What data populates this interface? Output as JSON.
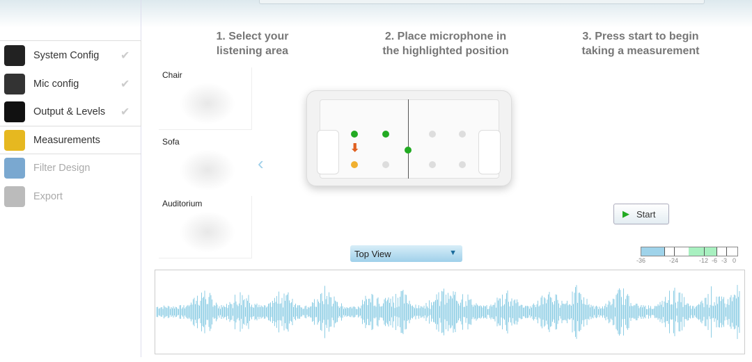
{
  "sidebar": {
    "items": [
      {
        "label": "System Config",
        "done": true,
        "icon": "speaker-icon",
        "enabled": true
      },
      {
        "label": "Mic config",
        "done": true,
        "icon": "microphone-icon",
        "enabled": true
      },
      {
        "label": "Output & Levels",
        "done": true,
        "icon": "knob-icon",
        "enabled": true
      },
      {
        "label": "Measurements",
        "done": false,
        "icon": "tape-measure-icon",
        "enabled": true,
        "active": true
      },
      {
        "label": "Filter Design",
        "done": false,
        "icon": "waveform-monitor-icon",
        "enabled": false
      },
      {
        "label": "Export",
        "done": false,
        "icon": "export-icon",
        "enabled": false
      }
    ]
  },
  "steps": [
    "1. Select your\nlistening area",
    "2. Place microphone in\nthe highlighted position",
    "3. Press start to begin\ntaking a measurement"
  ],
  "areas": [
    "Chair",
    "Sofa",
    "Auditorium"
  ],
  "view_select": "Top View",
  "start_label": "Start",
  "meter": {
    "ticks": [
      "-36",
      "-24",
      "-12",
      "-6",
      "-3",
      "0"
    ],
    "blue_range_db": [
      -36,
      -30
    ],
    "green_range_db": [
      -18,
      -6
    ],
    "colors": {
      "blue": "#9fd3ea",
      "green": "#a8f0c0"
    }
  },
  "colors": {
    "accent": "#9fd0ea",
    "waveform": "#8ccde4",
    "mic_done": "#22aa22",
    "mic_current": "#f0b030",
    "arrow": "#e06020"
  }
}
